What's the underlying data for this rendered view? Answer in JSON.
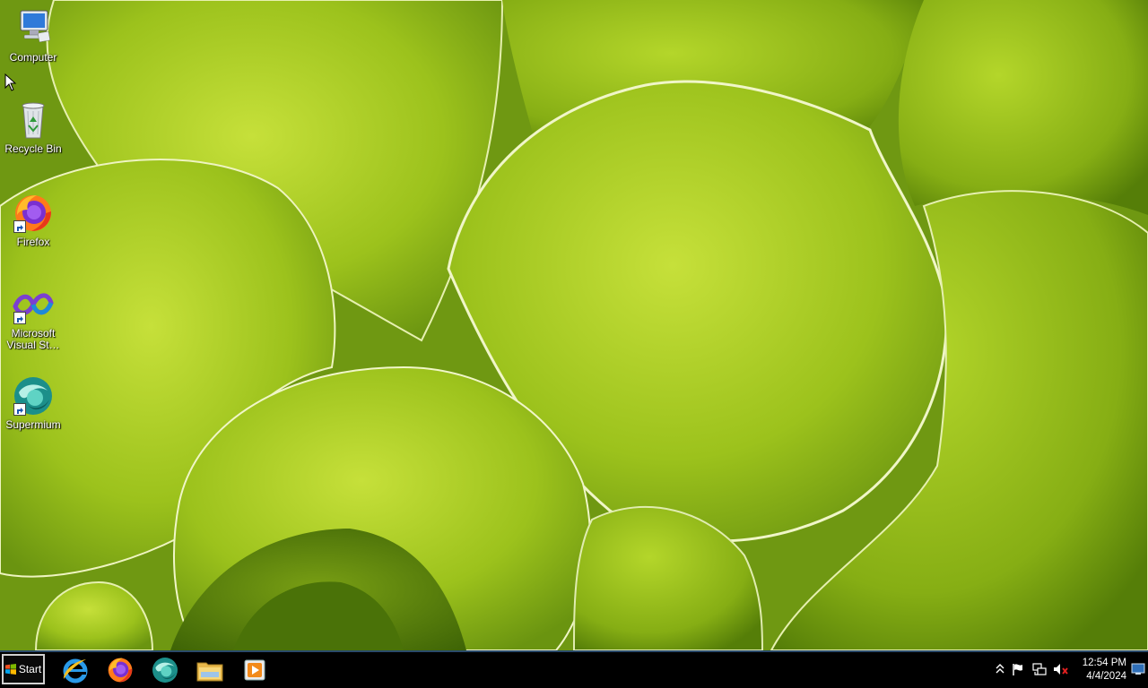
{
  "desktop": {
    "icons": [
      {
        "label": "Computer",
        "icon": "computer-icon",
        "shortcut": false
      },
      {
        "label": "Recycle Bin",
        "icon": "recycle-bin-icon",
        "shortcut": false
      },
      {
        "label": "Firefox",
        "icon": "firefox-icon",
        "shortcut": true
      },
      {
        "label": "Microsoft Visual St…",
        "icon": "visual-studio-icon",
        "shortcut": true
      },
      {
        "label": "Supermium",
        "icon": "supermium-icon",
        "shortcut": true
      }
    ]
  },
  "taskbar": {
    "start_label": "Start",
    "pinned": [
      {
        "name": "internet-explorer",
        "icon": "internet-explorer-icon"
      },
      {
        "name": "firefox",
        "icon": "firefox-icon"
      },
      {
        "name": "supermium",
        "icon": "supermium-icon"
      },
      {
        "name": "file-explorer",
        "icon": "folder-icon"
      },
      {
        "name": "media-player",
        "icon": "media-player-icon"
      }
    ],
    "tray": {
      "icons": [
        "show-hidden-icons-icon",
        "action-center-flag-icon",
        "network-icon",
        "volume-muted-icon",
        "show-desktop-icon"
      ],
      "time": "12:54 PM",
      "date": "4/4/2024"
    }
  },
  "colors": {
    "taskbar_bg": "#000000",
    "taskbar_border": "#2a4a6a",
    "wallpaper_light": "#c8e040",
    "wallpaper_dark": "#4f7a08"
  }
}
